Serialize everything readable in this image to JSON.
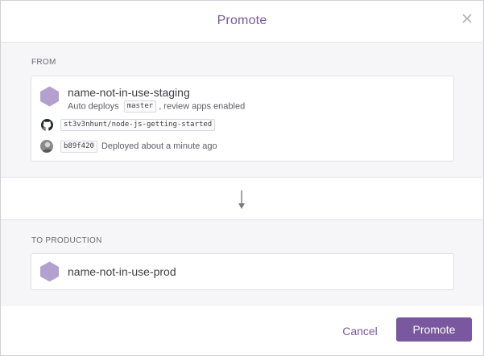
{
  "dialog": {
    "title": "Promote",
    "close_icon": "close-icon"
  },
  "from": {
    "label": "FROM",
    "app_name": "name-not-in-use-staging",
    "auto_deploys_prefix": "Auto deploys",
    "branch": "master",
    "auto_deploys_suffix": ", review apps enabled",
    "repo": "st3v3nhunt/node-js-getting-started",
    "commit": "b89f420",
    "deployed_text": "Deployed about a minute ago",
    "icons": [
      "app-hexagon-icon",
      "github-icon",
      "avatar"
    ]
  },
  "to": {
    "label": "TO PRODUCTION",
    "app_name": "name-not-in-use-prod",
    "icons": [
      "app-hexagon-icon"
    ]
  },
  "arrow_icon": "arrow-down-icon",
  "footer": {
    "cancel_label": "Cancel",
    "promote_label": "Promote"
  },
  "colors": {
    "accent": "#79589f",
    "app_icon": "#b3a0cf"
  }
}
